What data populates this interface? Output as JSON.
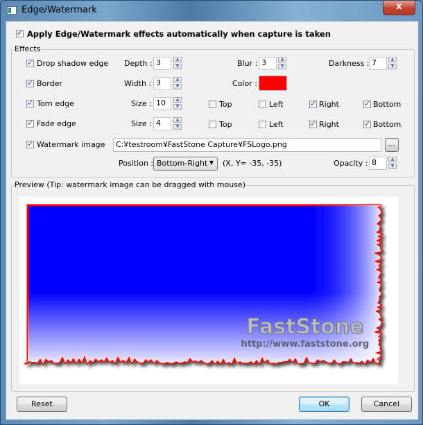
{
  "window": {
    "title": "Edge/Watermark",
    "close_label": "x"
  },
  "auto_apply": {
    "label": "Apply Edge/Watermark effects automatically when capture is taken",
    "checked": true
  },
  "effects": {
    "group_label": "Effects",
    "drop_shadow": {
      "label": "Drop shadow edge",
      "checked": true,
      "depth_label": "Depth :",
      "depth": "3",
      "blur_label": "Blur :",
      "blur": "3",
      "darkness_label": "Darkness :",
      "darkness": "7"
    },
    "border": {
      "label": "Border",
      "checked": true,
      "width_label": "Width :",
      "width": "3",
      "color_label": "Color :",
      "color": "#ff0000"
    },
    "torn_edge": {
      "label": "Torn edge",
      "checked": true,
      "size_label": "Size :",
      "size": "10",
      "sides": [
        {
          "label": "Top",
          "checked": false
        },
        {
          "label": "Left",
          "checked": false
        },
        {
          "label": "Right",
          "checked": true
        },
        {
          "label": "Bottom",
          "checked": true
        }
      ]
    },
    "fade_edge": {
      "label": "Fade edge",
      "checked": true,
      "size_label": "Size :",
      "size": "4",
      "sides": [
        {
          "label": "Top",
          "checked": false
        },
        {
          "label": "Left",
          "checked": false
        },
        {
          "label": "Right",
          "checked": true
        },
        {
          "label": "Bottom",
          "checked": true
        }
      ]
    },
    "watermark": {
      "label": "Watermark image",
      "checked": true,
      "path": "C:¥testroom¥FastStone Capture¥FSLogo.png",
      "browse_label": "...",
      "position_label": "Position :",
      "position": "Bottom-Right",
      "coords": "(X, Y= -35, -35)",
      "opacity_label": "Opacity :",
      "opacity": "8"
    }
  },
  "preview": {
    "group_label": "Preview (Tip: watermark image can be dragged with mouse)",
    "watermark_title": "FastStone",
    "watermark_url": "http://www.faststone.org",
    "fill_color": "#0000ff",
    "border_color": "#ff0000"
  },
  "buttons": {
    "reset": "Reset",
    "ok": "OK",
    "cancel": "Cancel"
  }
}
